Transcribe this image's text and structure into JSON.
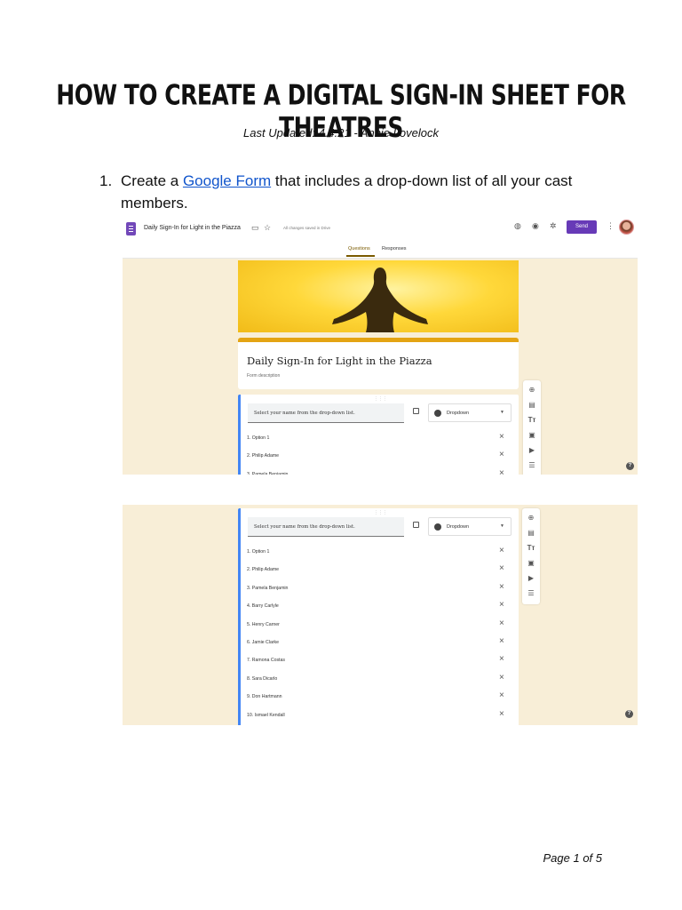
{
  "document": {
    "title": "How to Create a Digital Sign-In Sheet for Theatres",
    "subtitle": "Last Updated: 4.4.21 - Annie Lovelock",
    "step1": {
      "number": "1.",
      "text_before": "Create a ",
      "link_text": "Google Form",
      "text_after": " that includes a drop-down list of all your cast members."
    },
    "footer": "Page 1 of 5"
  },
  "form_app": {
    "doc_title": "Daily Sign-In for Light in the Piazza",
    "saved_status": "All changes saved in Drive",
    "send_label": "Send",
    "tabs": [
      "Questions",
      "Responses"
    ],
    "form_title": "Daily Sign-In for Light in the Piazza",
    "form_description": "Form description",
    "question": "Select your name from the drop-down list.",
    "question_type": "Dropdown",
    "options": [
      "1.  Option 1",
      "2.  Philip Adame",
      "3.  Pamela Benjamin",
      "4.  Barry Carlyle",
      "5.  Henry Carner",
      "6.  Jamie Clarke",
      "7.  Ramona Costas",
      "8.  Sara Dicarlo",
      "9.  Don Hartmann",
      "10.  Ismael Kendall"
    ],
    "remove_glyph": "×",
    "help_glyph": "?",
    "accent_color": "#673ab7",
    "theme_color": "#e4a413",
    "background_color": "#f8eed7"
  }
}
